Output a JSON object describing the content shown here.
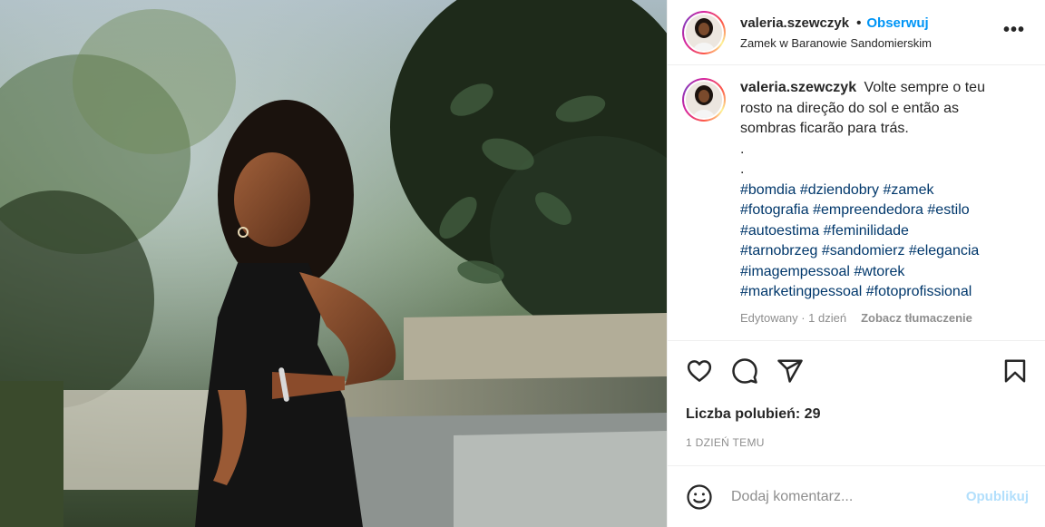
{
  "post": {
    "username": "valeria.szewczyk",
    "follow_label": "Obserwuj",
    "location": "Zamek w Baranowie Sandomierskim",
    "more_label": "•••"
  },
  "caption": {
    "username": "valeria.szewczyk",
    "text": "Volte sempre o teu rosto na direção do sol e então as sombras ficarão para trás.",
    "dot1": ".",
    "dot2": ".",
    "hashtags": [
      "#bomdia",
      "#dziendobry",
      "#zamek",
      "#fotografia",
      "#empreendedora",
      "#estilo",
      "#autoestima",
      "#feminilidade",
      "#tarnobrzeg",
      "#sandomierz",
      "#elegancia",
      "#imagempessoal",
      "#wtorek",
      "#marketingpessoal",
      "#fotoprofissional"
    ],
    "edited": "Edytowany · 1 dzień",
    "translate": "Zobacz tłumaczenie"
  },
  "likes_text": "Liczba polubień: 29",
  "time_text": "1 DZIEŃ TEMU",
  "comment": {
    "placeholder": "Dodaj komentarz...",
    "publish_label": "Opublikuj"
  },
  "icons": {
    "like": "heart-icon",
    "comment": "comment-icon",
    "share": "send-icon",
    "save": "bookmark-icon",
    "emoji": "emoji-icon",
    "more": "more-options-icon"
  }
}
